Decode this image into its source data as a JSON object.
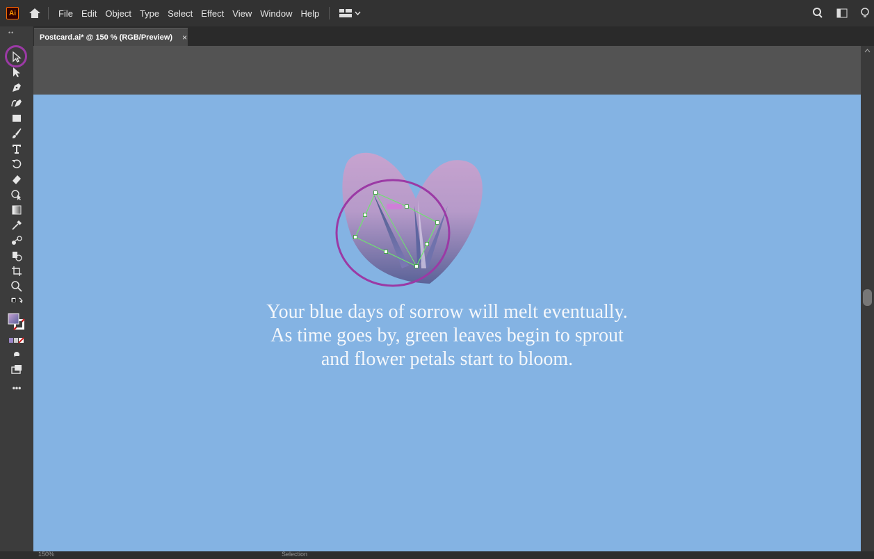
{
  "app": {
    "logo_text": "Ai",
    "menu": [
      "File",
      "Edit",
      "Object",
      "Type",
      "Select",
      "Effect",
      "View",
      "Window",
      "Help"
    ]
  },
  "document": {
    "tab_title": "Postcard.ai* @ 150 % (RGB/Preview)",
    "tab_close": "×"
  },
  "toolbar": {
    "grip": "••",
    "tools": [
      {
        "name": "selection-tool",
        "icon": "selection-arrow-outline-icon",
        "selected": true
      },
      {
        "name": "direct-selection-tool",
        "icon": "direct-selection-arrow-icon"
      },
      {
        "name": "pen-tool",
        "icon": "pen-icon"
      },
      {
        "name": "curvature-tool",
        "icon": "curvature-pen-icon"
      },
      {
        "name": "rectangle-tool",
        "icon": "rectangle-icon"
      },
      {
        "name": "paintbrush-tool",
        "icon": "paintbrush-icon"
      },
      {
        "name": "type-tool",
        "icon": "type-icon"
      },
      {
        "name": "rotate-tool",
        "icon": "rotate-icon"
      },
      {
        "name": "eraser-tool",
        "icon": "eraser-icon"
      },
      {
        "name": "shape-builder-tool",
        "icon": "shape-builder-icon"
      },
      {
        "name": "gradient-tool",
        "icon": "gradient-icon"
      },
      {
        "name": "eyedropper-tool",
        "icon": "eyedropper-icon"
      },
      {
        "name": "blend-tool",
        "icon": "blend-icon"
      },
      {
        "name": "symbol-sprayer-tool",
        "icon": "symbol-sprayer-icon"
      },
      {
        "name": "artboard-tool",
        "icon": "artboard-icon"
      },
      {
        "name": "zoom-tool",
        "icon": "zoom-icon"
      },
      {
        "name": "default-colors-swap",
        "icon": "swap-colors-icon"
      },
      {
        "name": "fill-stroke-swatch",
        "icon": "fill-stroke-icon"
      },
      {
        "name": "color-modes",
        "icon": "color-mode-icon"
      },
      {
        "name": "draw-modes",
        "icon": "draw-mode-icon"
      },
      {
        "name": "screen-mode",
        "icon": "screen-mode-icon"
      },
      {
        "name": "edit-toolbar",
        "icon": "more-dots-icon"
      }
    ],
    "more_label": "•••"
  },
  "artboard": {
    "text_lines": [
      "Your blue days of sorrow will melt eventually.",
      "As time goes by, green leaves begin to sprout",
      "and flower petals start to bloom."
    ]
  },
  "status": {
    "zoom": "150%",
    "mode": "Selection"
  },
  "colors": {
    "artboard_bg": "#84b3e3",
    "callout": "#9b3aa5",
    "selection_bbox": "#6ee56e",
    "heart_top": "#c79cc8",
    "heart_bottom": "#5e6a9c"
  }
}
